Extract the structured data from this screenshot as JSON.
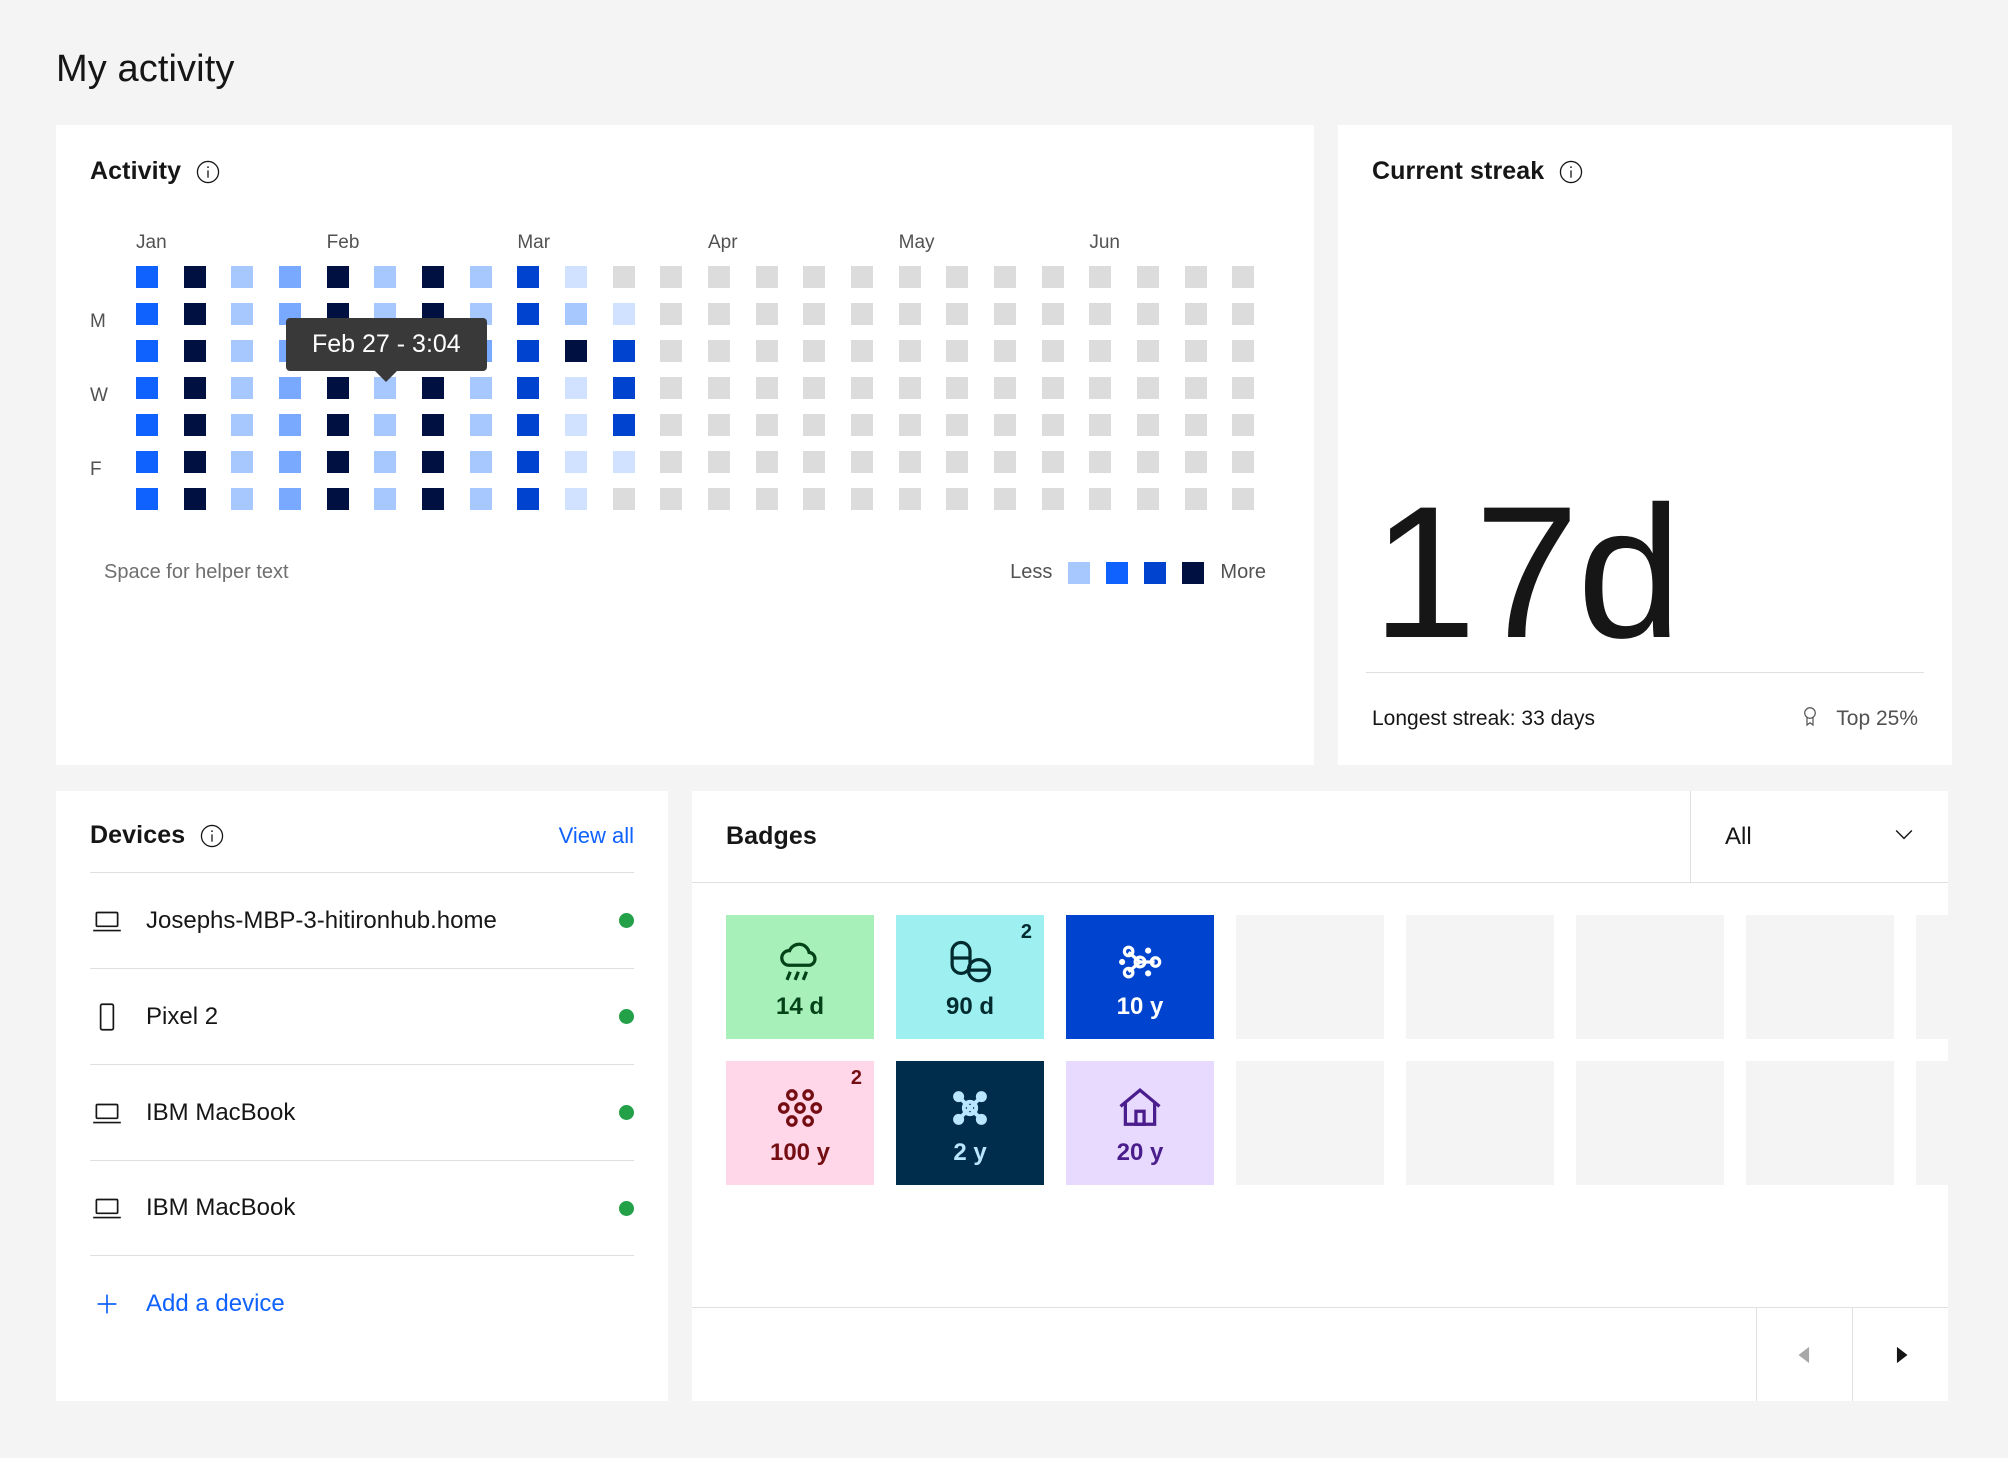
{
  "page": {
    "title": "My activity"
  },
  "activity": {
    "title": "Activity",
    "info_icon": "info-icon",
    "helper_text": "Space for helper text",
    "legend": {
      "less_label": "Less",
      "more_label": "More",
      "swatches": [
        "#a6c8ff",
        "#0f62fe",
        "#0043ce",
        "#001141"
      ]
    },
    "tooltip": {
      "text": "Feb 27 - 3:04"
    },
    "months": [
      "Jan",
      "Feb",
      "Mar",
      "Apr",
      "May",
      "Jun"
    ],
    "month_columns": [
      0,
      4,
      8,
      12,
      16,
      20
    ],
    "day_labels": [
      "",
      "M",
      "",
      "W",
      "",
      "F",
      ""
    ],
    "empty_color": "#dcdcdc",
    "chart_data": {
      "type": "heatmap",
      "title": "Activity",
      "xlabel": "",
      "ylabel": "",
      "columns": 24,
      "rows": 7,
      "row_labels": [
        "",
        "M",
        "",
        "W",
        "",
        "F",
        ""
      ],
      "col_month_labels": [
        "Jan",
        "",
        "",
        "",
        "Feb",
        "",
        "",
        "",
        "Mar",
        "",
        "",
        "",
        "Apr",
        "",
        "",
        "",
        "May",
        "",
        "",
        "",
        "Jun",
        "",
        "",
        ""
      ],
      "levels": [
        "#dcdcdc",
        "#d0e2ff",
        "#a6c8ff",
        "#78a9ff",
        "#0f62fe",
        "#0043ce",
        "#001141"
      ],
      "legend": {
        "less": "Less",
        "more": "More",
        "scale": [
          "#a6c8ff",
          "#0f62fe",
          "#0043ce",
          "#001141"
        ]
      },
      "grid": [
        [
          "#0f62fe",
          "#001141",
          "#a6c8ff",
          "#78a9ff",
          "#001141",
          "#a6c8ff",
          "#001141",
          "#a6c8ff",
          "#0043ce",
          "#d0e2ff",
          "#dcdcdc",
          "#dcdcdc",
          "#dcdcdc",
          "#dcdcdc",
          "#dcdcdc",
          "#dcdcdc",
          "#dcdcdc",
          "#dcdcdc",
          "#dcdcdc",
          "#dcdcdc",
          "#dcdcdc",
          "#dcdcdc",
          "#dcdcdc",
          "#dcdcdc"
        ],
        [
          "#0f62fe",
          "#001141",
          "#a6c8ff",
          "#78a9ff",
          "#001141",
          "#a6c8ff",
          "#001141",
          "#a6c8ff",
          "#0043ce",
          "#a6c8ff",
          "#d0e2ff",
          "#dcdcdc",
          "#dcdcdc",
          "#dcdcdc",
          "#dcdcdc",
          "#dcdcdc",
          "#dcdcdc",
          "#dcdcdc",
          "#dcdcdc",
          "#dcdcdc",
          "#dcdcdc",
          "#dcdcdc",
          "#dcdcdc",
          "#dcdcdc"
        ],
        [
          "#0f62fe",
          "#001141",
          "#a6c8ff",
          "#78a9ff",
          "#001141",
          "#a6c8ff",
          "#001141",
          "#78a9ff",
          "#0043ce",
          "#001141",
          "#0043ce",
          "#dcdcdc",
          "#dcdcdc",
          "#dcdcdc",
          "#dcdcdc",
          "#dcdcdc",
          "#dcdcdc",
          "#dcdcdc",
          "#dcdcdc",
          "#dcdcdc",
          "#dcdcdc",
          "#dcdcdc",
          "#dcdcdc",
          "#dcdcdc"
        ],
        [
          "#0f62fe",
          "#001141",
          "#a6c8ff",
          "#78a9ff",
          "#001141",
          "#a6c8ff",
          "#001141",
          "#a6c8ff",
          "#0043ce",
          "#d0e2ff",
          "#0043ce",
          "#dcdcdc",
          "#dcdcdc",
          "#dcdcdc",
          "#dcdcdc",
          "#dcdcdc",
          "#dcdcdc",
          "#dcdcdc",
          "#dcdcdc",
          "#dcdcdc",
          "#dcdcdc",
          "#dcdcdc",
          "#dcdcdc",
          "#dcdcdc"
        ],
        [
          "#0f62fe",
          "#001141",
          "#a6c8ff",
          "#78a9ff",
          "#001141",
          "#a6c8ff",
          "#001141",
          "#a6c8ff",
          "#0043ce",
          "#d0e2ff",
          "#0043ce",
          "#dcdcdc",
          "#dcdcdc",
          "#dcdcdc",
          "#dcdcdc",
          "#dcdcdc",
          "#dcdcdc",
          "#dcdcdc",
          "#dcdcdc",
          "#dcdcdc",
          "#dcdcdc",
          "#dcdcdc",
          "#dcdcdc",
          "#dcdcdc"
        ],
        [
          "#0f62fe",
          "#001141",
          "#a6c8ff",
          "#78a9ff",
          "#001141",
          "#a6c8ff",
          "#001141",
          "#a6c8ff",
          "#0043ce",
          "#d0e2ff",
          "#d0e2ff",
          "#dcdcdc",
          "#dcdcdc",
          "#dcdcdc",
          "#dcdcdc",
          "#dcdcdc",
          "#dcdcdc",
          "#dcdcdc",
          "#dcdcdc",
          "#dcdcdc",
          "#dcdcdc",
          "#dcdcdc",
          "#dcdcdc",
          "#dcdcdc"
        ],
        [
          "#0f62fe",
          "#001141",
          "#a6c8ff",
          "#78a9ff",
          "#001141",
          "#a6c8ff",
          "#001141",
          "#a6c8ff",
          "#0043ce",
          "#d0e2ff",
          "#dcdcdc",
          "#dcdcdc",
          "#dcdcdc",
          "#dcdcdc",
          "#dcdcdc",
          "#dcdcdc",
          "#dcdcdc",
          "#dcdcdc",
          "#dcdcdc",
          "#dcdcdc",
          "#dcdcdc",
          "#dcdcdc",
          "#dcdcdc",
          "#dcdcdc"
        ]
      ]
    }
  },
  "streak": {
    "title": "Current streak",
    "value": "17d",
    "longest": "Longest streak: 33 days",
    "rank": "Top 25%",
    "rank_icon": "medal-icon"
  },
  "devices": {
    "title": "Devices",
    "view_all_label": "View all",
    "add_label": "Add a device",
    "status_color": "#24a148",
    "items": [
      {
        "name": "Josephs-MBP-3-hitironhub.home",
        "icon": "laptop-icon",
        "status": "online"
      },
      {
        "name": "Pixel 2",
        "icon": "phone-icon",
        "status": "online"
      },
      {
        "name": "IBM MacBook",
        "icon": "laptop-icon",
        "status": "online"
      },
      {
        "name": "IBM MacBook",
        "icon": "laptop-icon",
        "status": "online"
      }
    ]
  },
  "badges": {
    "title": "Badges",
    "filter_value": "All",
    "prev_label": "Previous",
    "next_label": "Next",
    "items": [
      {
        "label": "14 d",
        "glyph": "rain-cloud-icon",
        "bg": "#a7f0ba",
        "fg": "#044317",
        "count": ""
      },
      {
        "label": "90 d",
        "glyph": "pills-icon",
        "bg": "#9ef0f0",
        "fg": "#022b30",
        "count": "2"
      },
      {
        "label": "10 y",
        "glyph": "network-icon",
        "bg": "#0043ce",
        "fg": "#ffffff",
        "count": ""
      },
      {
        "label": "",
        "glyph": "",
        "bg": "#f4f4f4",
        "fg": "",
        "count": ""
      },
      {
        "label": "",
        "glyph": "",
        "bg": "#f4f4f4",
        "fg": "",
        "count": ""
      },
      {
        "label": "",
        "glyph": "",
        "bg": "#f4f4f4",
        "fg": "",
        "count": ""
      },
      {
        "label": "",
        "glyph": "",
        "bg": "#f4f4f4",
        "fg": "",
        "count": ""
      },
      {
        "label": "",
        "glyph": "",
        "bg": "#f4f4f4",
        "fg": "",
        "count": ""
      },
      {
        "label": "100 y",
        "glyph": "dots-icon",
        "bg": "#ffd7e8",
        "fg": "#750e13",
        "count": "2"
      },
      {
        "label": "2 y",
        "glyph": "hub-icon",
        "bg": "#002d4b",
        "fg": "#bae6ff",
        "count": ""
      },
      {
        "label": "20 y",
        "glyph": "home-icon",
        "bg": "#e8daff",
        "fg": "#491d8b",
        "count": ""
      },
      {
        "label": "",
        "glyph": "",
        "bg": "#f4f4f4",
        "fg": "",
        "count": ""
      },
      {
        "label": "",
        "glyph": "",
        "bg": "#f4f4f4",
        "fg": "",
        "count": ""
      },
      {
        "label": "",
        "glyph": "",
        "bg": "#f4f4f4",
        "fg": "",
        "count": ""
      },
      {
        "label": "",
        "glyph": "",
        "bg": "#f4f4f4",
        "fg": "",
        "count": ""
      },
      {
        "label": "",
        "glyph": "",
        "bg": "#f4f4f4",
        "fg": "",
        "count": ""
      }
    ]
  }
}
